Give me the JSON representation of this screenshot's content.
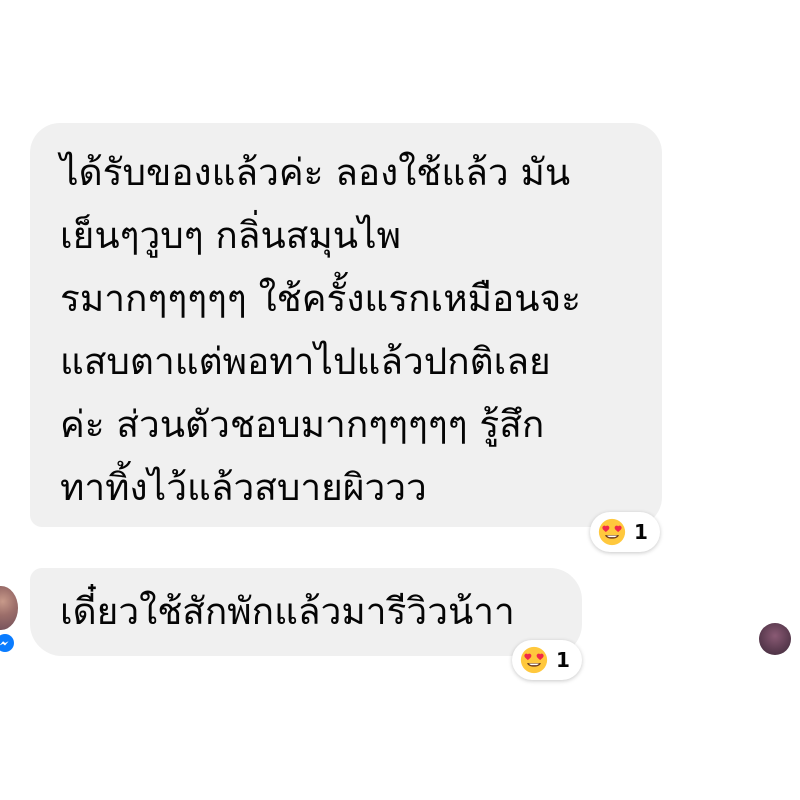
{
  "conversation": {
    "messages": [
      {
        "lines": [
          "ได้รับของแล้วค่ะ ลองใช้แล้ว มัน",
          "เย็นๆวูบๆ กลิ่นสมุนไพ",
          "รมากๆๆๆๆๆ ใช้ครั้งแรกเหมือนจะ",
          "แสบตาแต่พอทาไปแล้วปกติเลย",
          "ค่ะ ส่วนตัวชอบมากๆๆๆๆๆ รู้สึก",
          "ทาทิ้งไว้แล้วสบายผิววว"
        ],
        "reaction": {
          "emoji": "heart-eyes",
          "count": "1"
        }
      },
      {
        "lines": [
          "เดี๋ยวใช้สักพักแล้วมารีวิวน้าา"
        ],
        "reaction": {
          "emoji": "heart-eyes",
          "count": "1"
        }
      }
    ]
  },
  "colors": {
    "bubble_bg": "#f0f0f0",
    "text": "#050505",
    "messenger_blue": "#0a7cff",
    "emoji_face": "#ffc83d",
    "emoji_heart": "#f0284a"
  }
}
